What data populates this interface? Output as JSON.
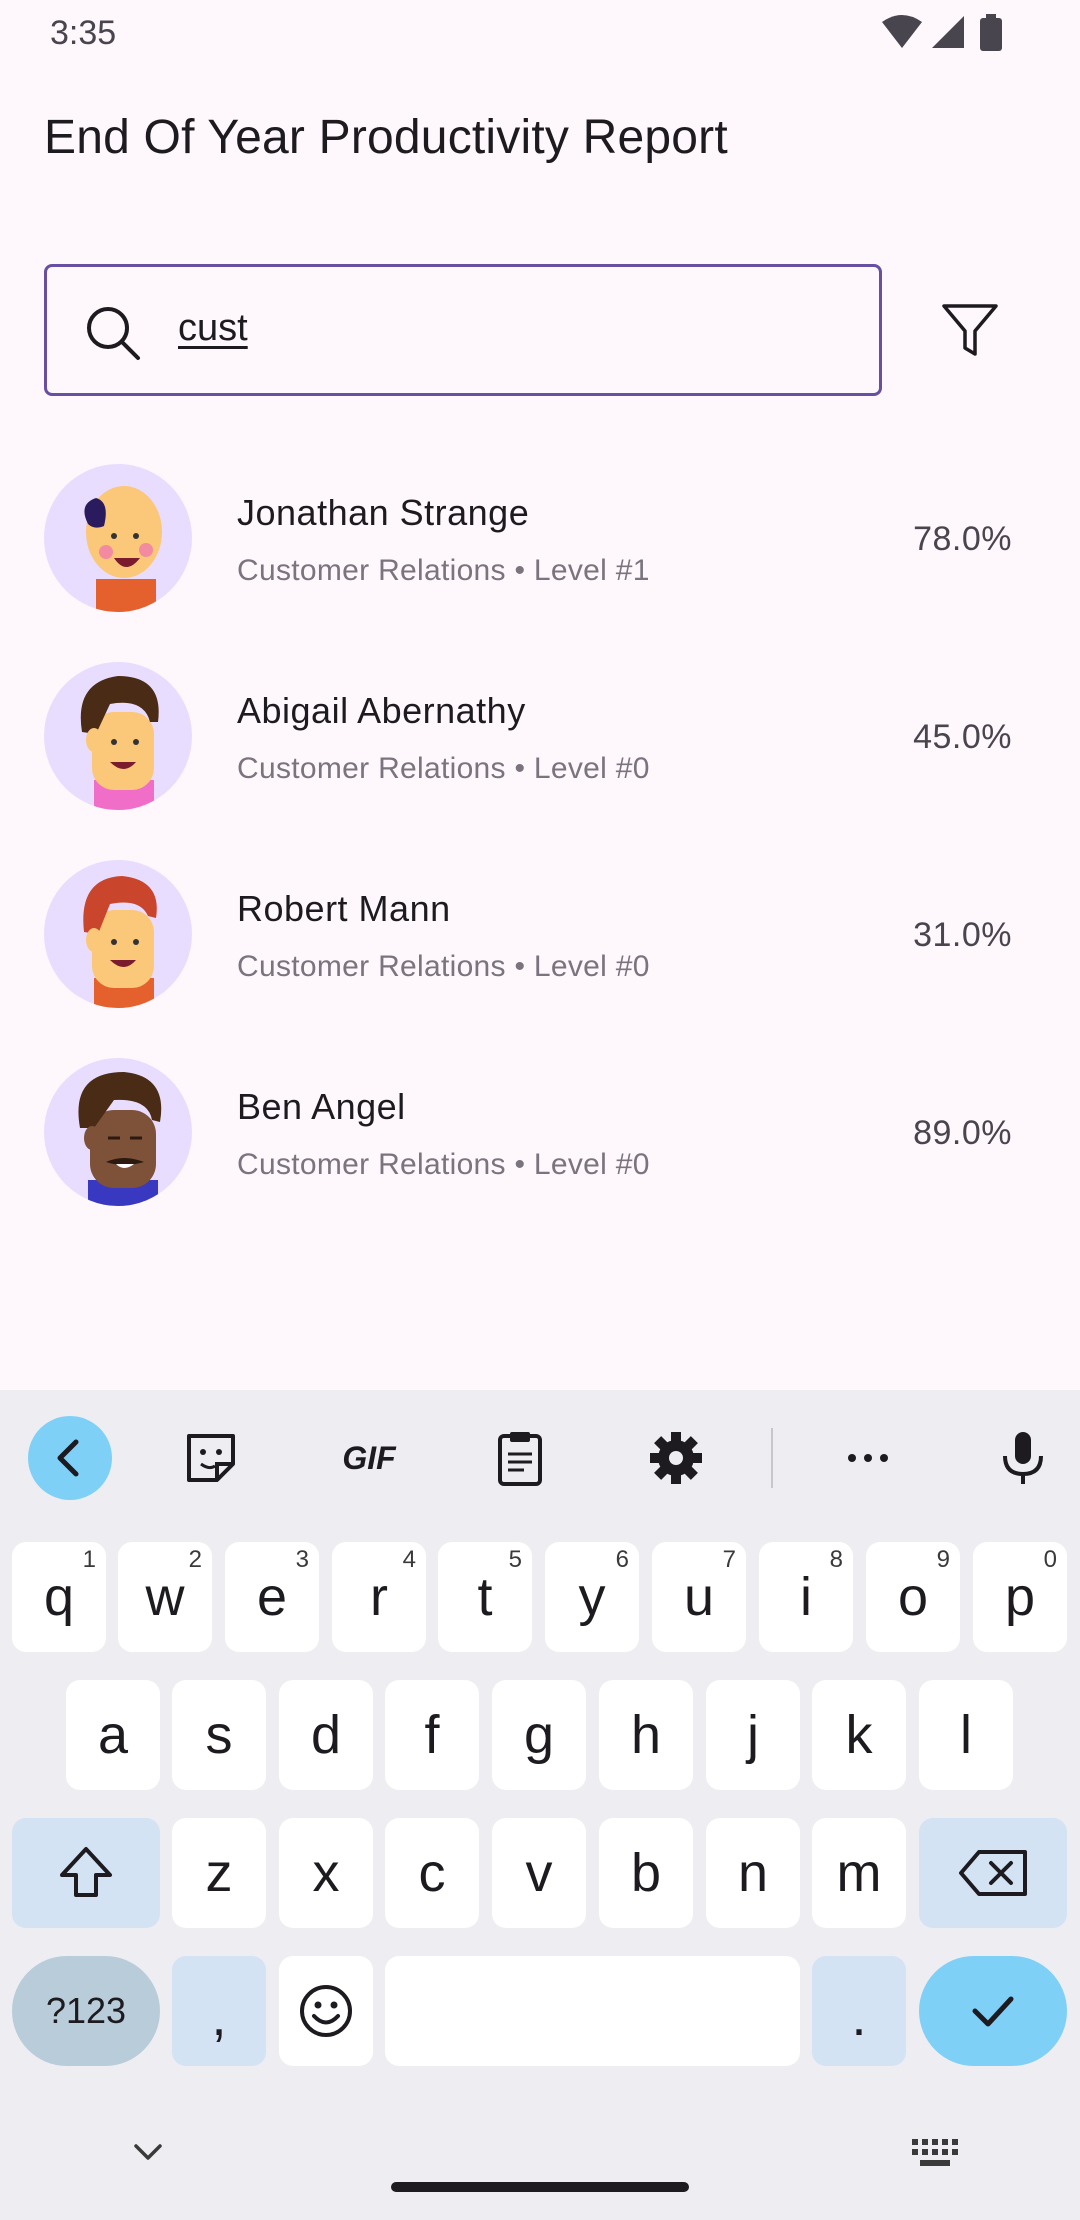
{
  "status": {
    "time": "3:35"
  },
  "header": {
    "title": "End Of Year Productivity Report"
  },
  "search": {
    "value": "cust"
  },
  "employees": [
    {
      "name": "Jonathan Strange",
      "subtitle": "Customer Relations • Level #1",
      "percent": "78.0%"
    },
    {
      "name": "Abigail Abernathy",
      "subtitle": "Customer Relations • Level #0",
      "percent": "45.0%"
    },
    {
      "name": "Robert Mann",
      "subtitle": "Customer Relations • Level #0",
      "percent": "31.0%"
    },
    {
      "name": "Ben Angel",
      "subtitle": "Customer Relations • Level #0",
      "percent": "89.0%"
    }
  ],
  "keyboard": {
    "toolbar": [
      "back-icon",
      "sticker-icon",
      "gif-icon",
      "clipboard-icon",
      "settings-icon",
      "more-icon",
      "mic-icon"
    ],
    "gif_label": "GIF",
    "row1": [
      {
        "k": "q",
        "h": "1"
      },
      {
        "k": "w",
        "h": "2"
      },
      {
        "k": "e",
        "h": "3"
      },
      {
        "k": "r",
        "h": "4"
      },
      {
        "k": "t",
        "h": "5"
      },
      {
        "k": "y",
        "h": "6"
      },
      {
        "k": "u",
        "h": "7"
      },
      {
        "k": "i",
        "h": "8"
      },
      {
        "k": "o",
        "h": "9"
      },
      {
        "k": "p",
        "h": "0"
      }
    ],
    "row2": [
      "a",
      "s",
      "d",
      "f",
      "g",
      "h",
      "j",
      "k",
      "l"
    ],
    "row3": [
      "z",
      "x",
      "c",
      "v",
      "b",
      "n",
      "m"
    ],
    "sym_label": "?123",
    "comma": ",",
    "period": "."
  },
  "colors": {
    "accent": "#6750a4",
    "avatar_bg": "#e9ddff",
    "key_accent": "#7fd0f7"
  }
}
